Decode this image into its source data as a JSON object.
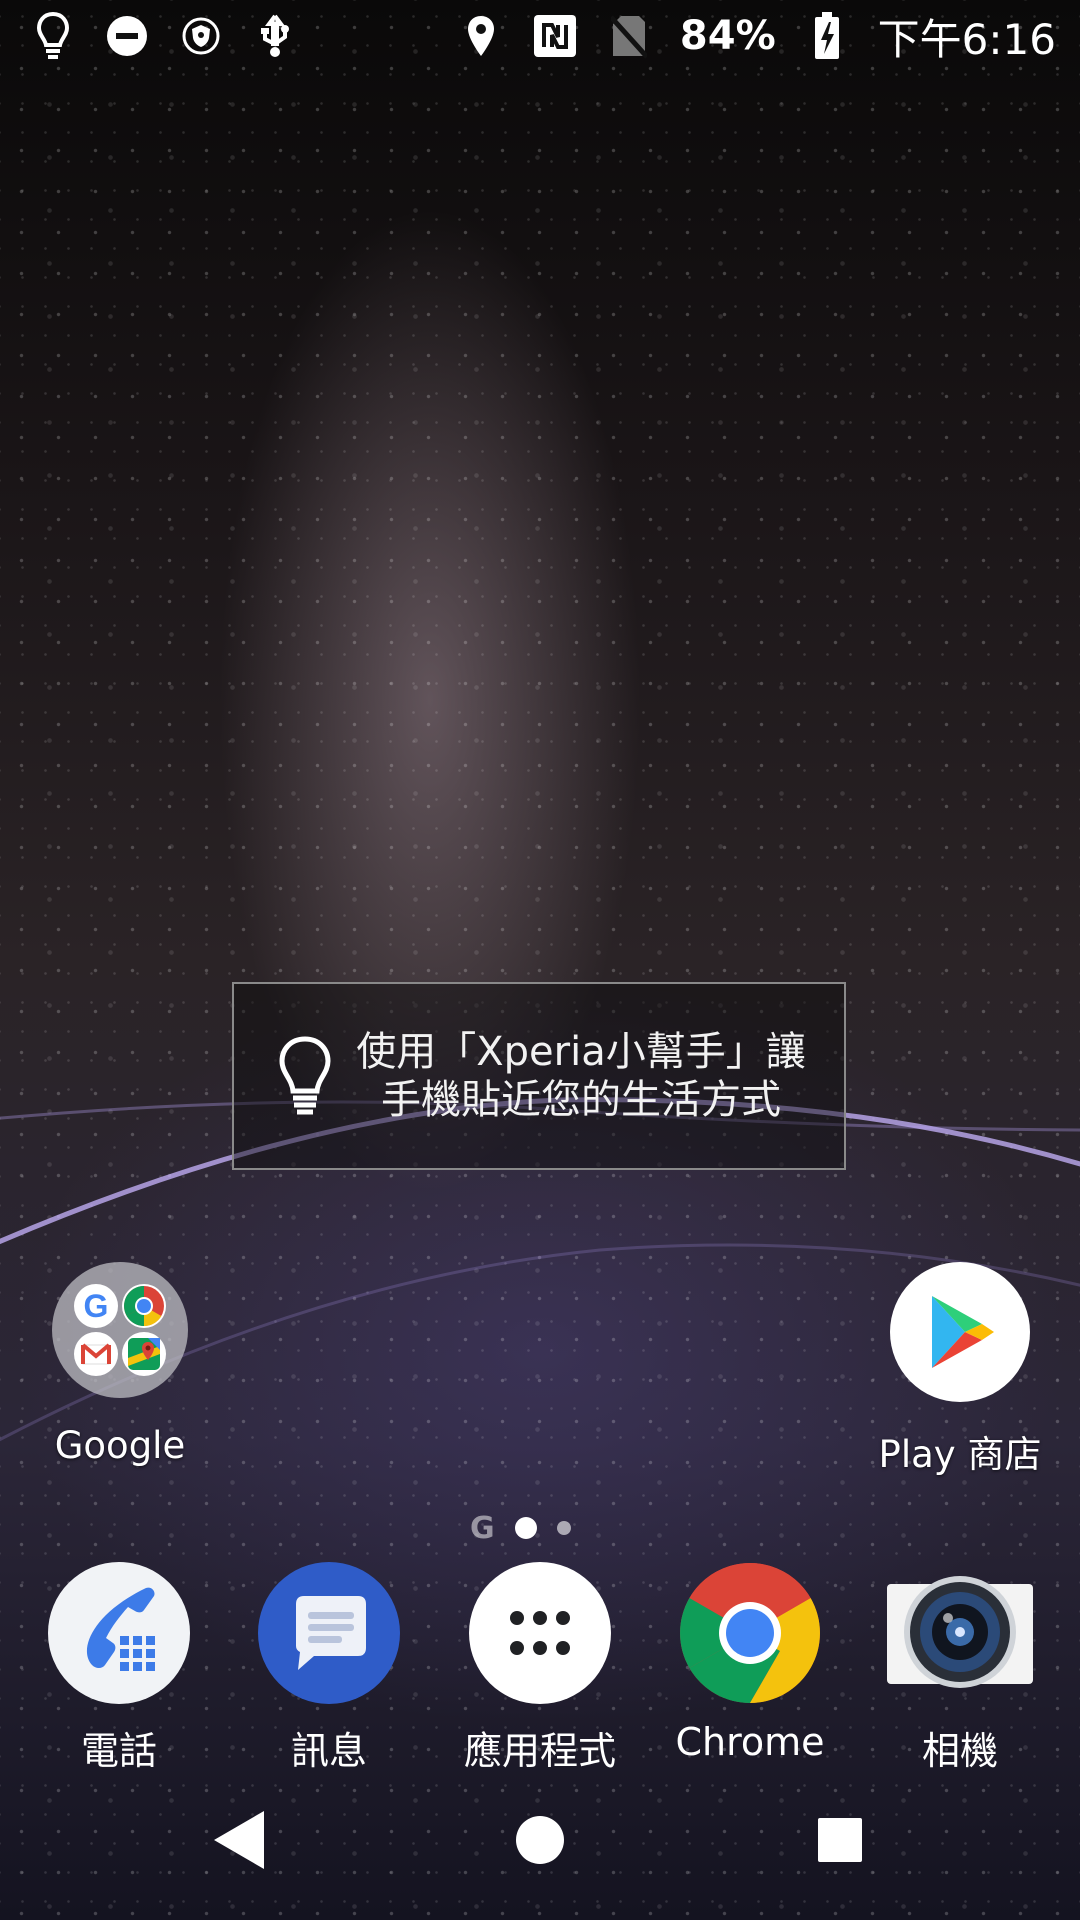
{
  "status_bar": {
    "left_icons": [
      "lightbulb-icon",
      "do-not-disturb-icon",
      "vpn-shield-icon",
      "usb-icon"
    ],
    "right_icons": [
      "location-icon",
      "nfc-icon",
      "no-sim-icon"
    ],
    "battery": "84%",
    "time": "下午6:16"
  },
  "assistant_tip": {
    "icon": "lightbulb-icon",
    "line1": "使用「Xperia小幫手」讓",
    "line2": "手機貼近您的生活方式"
  },
  "home": {
    "folder": {
      "label": "Google",
      "apps": [
        "google-icon",
        "chrome-icon",
        "gmail-icon",
        "maps-icon"
      ]
    },
    "play_store": {
      "label": "Play 商店"
    }
  },
  "page_indicator": {
    "google_label": "G",
    "pages": 2,
    "active": 1
  },
  "dock": [
    {
      "label": "電話",
      "icon": "phone-icon"
    },
    {
      "label": "訊息",
      "icon": "messages-icon"
    },
    {
      "label": "應用程式",
      "icon": "app-drawer-icon"
    },
    {
      "label": "Chrome",
      "icon": "chrome-icon"
    },
    {
      "label": "相機",
      "icon": "camera-icon"
    }
  ],
  "nav_bar": {
    "buttons": [
      "back-icon",
      "home-icon",
      "recents-icon"
    ]
  },
  "colors": {
    "chrome_red": "#db4437",
    "chrome_yellow": "#f4c20d",
    "chrome_green": "#0f9d58",
    "chrome_blue": "#4285f4",
    "messages_blue": "#2f5cc8",
    "phone_blue": "#3d7be8"
  }
}
